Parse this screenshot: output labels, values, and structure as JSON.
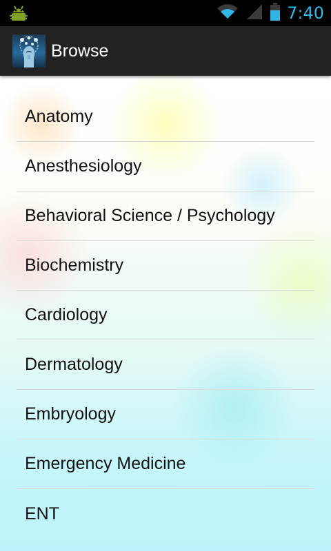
{
  "status_bar": {
    "time": "7:40",
    "icons": [
      "android-debug-icon",
      "wifi-icon",
      "cell-signal-icon",
      "battery-icon"
    ],
    "accent_color": "#33b5e5"
  },
  "action_bar": {
    "title": "Browse",
    "app_icon": "brain-app-icon"
  },
  "list": {
    "items": [
      {
        "label": "Anatomy"
      },
      {
        "label": "Anesthesiology"
      },
      {
        "label": "Behavioral Science / Psychology"
      },
      {
        "label": "Biochemistry"
      },
      {
        "label": "Cardiology"
      },
      {
        "label": "Dermatology"
      },
      {
        "label": "Embryology"
      },
      {
        "label": "Emergency Medicine"
      },
      {
        "label": "ENT"
      }
    ]
  }
}
